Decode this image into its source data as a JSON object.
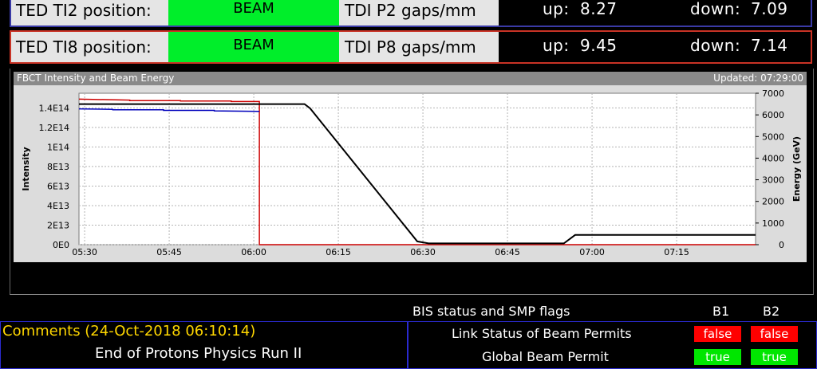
{
  "ted": [
    {
      "label": "TED TI2 position:",
      "state": "BEAM",
      "gap_label": "TDI P2 gaps/mm",
      "up_label": "up:",
      "up_value": "8.27",
      "down_label": "down:",
      "down_value": "7.09"
    },
    {
      "label": "TED TI8 position:",
      "state": "BEAM",
      "gap_label": "TDI P8 gaps/mm",
      "up_label": "up:",
      "up_value": "9.45",
      "down_label": "down:",
      "down_value": "7.14"
    }
  ],
  "chart": {
    "title": "FBCT Intensity and Beam Energy",
    "updated": "Updated: 07:29:00"
  },
  "chart_data": {
    "type": "line",
    "x_unit": "time",
    "x_ticks": [
      "05:30",
      "05:45",
      "06:00",
      "06:15",
      "06:30",
      "06:45",
      "07:00",
      "07:15"
    ],
    "x_range": [
      "05:29",
      "07:29"
    ],
    "ylabel": "Intensity",
    "y_ticks": [
      "0E0",
      "2E13",
      "4E13",
      "6E13",
      "8E13",
      "1E14",
      "1.2E14",
      "1.4E14"
    ],
    "ylim": [
      0,
      155000000000000.0
    ],
    "y2label": "Energy (GeV)",
    "y2_ticks": [
      "0",
      "1000",
      "2000",
      "3000",
      "4000",
      "5000",
      "6000",
      "7000"
    ],
    "y2lim": [
      0,
      7000
    ],
    "grid": true,
    "series": [
      {
        "color": "#cc0000",
        "axis": "left",
        "points": [
          [
            "05:29",
            149000000000000.0
          ],
          [
            "05:38",
            148000000000000.0
          ],
          [
            "05:38",
            147500000000000.0
          ],
          [
            "05:47",
            147500000000000.0
          ],
          [
            "05:47",
            147000000000000.0
          ],
          [
            "05:56",
            147000000000000.0
          ],
          [
            "05:56",
            146500000000000.0
          ],
          [
            "06:01",
            146500000000000.0
          ],
          [
            "06:01",
            0
          ],
          [
            "07:29",
            0
          ]
        ]
      },
      {
        "color": "#0000bb",
        "axis": "left",
        "points": [
          [
            "05:29",
            139000000000000.0
          ],
          [
            "05:35",
            138500000000000.0
          ],
          [
            "05:35",
            138000000000000.0
          ],
          [
            "05:44",
            138000000000000.0
          ],
          [
            "05:44",
            137500000000000.0
          ],
          [
            "05:53",
            137500000000000.0
          ],
          [
            "05:53",
            137000000000000.0
          ],
          [
            "06:01",
            136500000000000.0
          ]
        ]
      },
      {
        "color": "#000000",
        "axis": "right",
        "points": [
          [
            "05:29",
            6500
          ],
          [
            "06:09",
            6500
          ],
          [
            "06:10",
            6300
          ],
          [
            "06:29",
            150
          ],
          [
            "06:31",
            60
          ],
          [
            "06:55",
            60
          ],
          [
            "06:57",
            450
          ],
          [
            "07:29",
            450
          ]
        ]
      }
    ]
  },
  "bis": {
    "title": "BIS status and SMP flags",
    "b1": "B1",
    "b2": "B2",
    "rows": [
      {
        "label": "Link Status of Beam Permits",
        "b1": "false",
        "b2": "false"
      },
      {
        "label": "Global Beam Permit",
        "b1": "true",
        "b2": "true"
      }
    ]
  },
  "comments": {
    "title": "Comments (24-Oct-2018 06:10:14)",
    "text": "End of Protons Physics Run II"
  }
}
